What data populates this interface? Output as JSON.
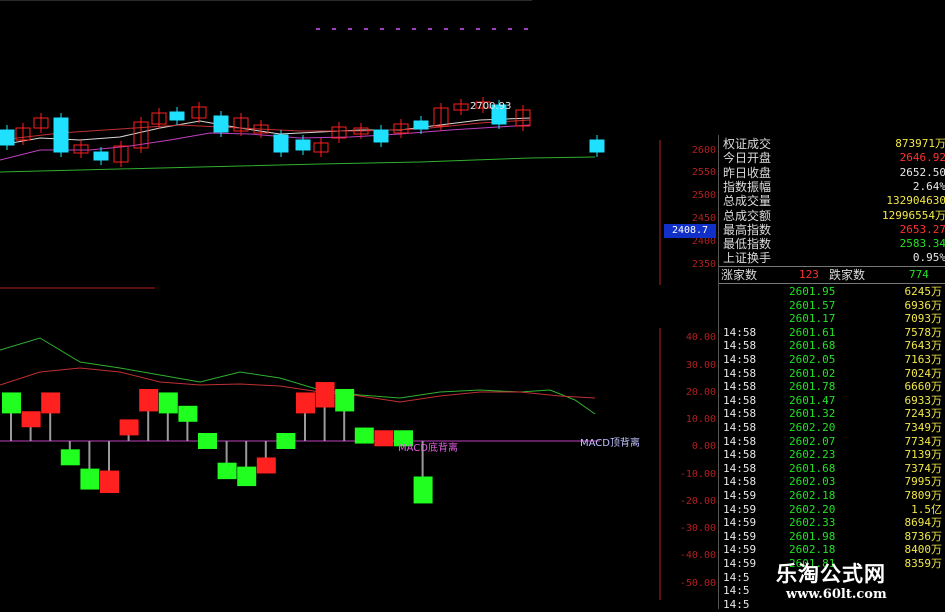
{
  "colors": {
    "up": "#ff2020",
    "down": "#20ff20",
    "axis": "#b02020",
    "ma_white": "#d8d8d8",
    "ma_purple": "#c040c0",
    "ma_green": "#30b030",
    "ma_red": "#c03030"
  },
  "price_chart": {
    "top_label": "2700.93",
    "axis_labels": [
      "2600",
      "2550",
      "2500",
      "2450",
      "2400",
      "2350"
    ],
    "current_price": "2408.7"
  },
  "quote_panel": {
    "rows": [
      {
        "label": "权证成交",
        "value": "873971万",
        "color": "#f2e84a"
      },
      {
        "label": "今日开盘",
        "value": "2646.92",
        "color": "#ff3030"
      },
      {
        "label": "昨日收盘",
        "value": "2652.50",
        "color": "#e8e8e8"
      },
      {
        "label": "指数振幅",
        "value": "2.64%",
        "color": "#e8e8e8"
      },
      {
        "label": "总成交量",
        "value": "132904630",
        "color": "#f2e84a"
      },
      {
        "label": "总成交额",
        "value": "12996554万",
        "color": "#f2e84a"
      },
      {
        "label": "最高指数",
        "value": "2653.27",
        "color": "#ff3030"
      },
      {
        "label": "最低指数",
        "value": "2583.34",
        "color": "#22e022"
      },
      {
        "label": "上证换手",
        "value": "0.95%",
        "color": "#e8e8e8"
      }
    ],
    "advance_label": "涨家数",
    "advance_value": "123",
    "decline_label": "跌家数",
    "decline_value": "774"
  },
  "ticks": [
    {
      "time": "",
      "price": "2601.95",
      "vol": "6245万"
    },
    {
      "time": "",
      "price": "2601.57",
      "vol": "6936万"
    },
    {
      "time": "",
      "price": "2601.17",
      "vol": "7093万"
    },
    {
      "time": "14:58",
      "price": "2601.61",
      "vol": "7578万"
    },
    {
      "time": "14:58",
      "price": "2601.68",
      "vol": "7643万"
    },
    {
      "time": "14:58",
      "price": "2602.05",
      "vol": "7163万"
    },
    {
      "time": "14:58",
      "price": "2601.02",
      "vol": "7024万"
    },
    {
      "time": "14:58",
      "price": "2601.78",
      "vol": "6660万"
    },
    {
      "time": "14:58",
      "price": "2601.47",
      "vol": "6933万"
    },
    {
      "time": "14:58",
      "price": "2601.32",
      "vol": "7243万"
    },
    {
      "time": "14:58",
      "price": "2602.20",
      "vol": "7349万"
    },
    {
      "time": "14:58",
      "price": "2602.07",
      "vol": "7734万"
    },
    {
      "time": "14:58",
      "price": "2602.23",
      "vol": "7139万"
    },
    {
      "time": "14:58",
      "price": "2601.68",
      "vol": "7374万"
    },
    {
      "time": "14:58",
      "price": "2602.03",
      "vol": "7995万"
    },
    {
      "time": "14:59",
      "price": "2602.18",
      "vol": "7809万"
    },
    {
      "time": "14:59",
      "price": "2602.20",
      "vol": "1.5亿"
    },
    {
      "time": "14:59",
      "price": "2602.33",
      "vol": "8694万"
    },
    {
      "time": "14:59",
      "price": "2601.98",
      "vol": "8736万"
    },
    {
      "time": "14:59",
      "price": "2602.18",
      "vol": "8400万"
    },
    {
      "time": "14:59",
      "price": "2601.81",
      "vol": "8359万"
    },
    {
      "time": "14:5",
      "price": "",
      "vol": ""
    },
    {
      "time": "14:5",
      "price": "",
      "vol": ""
    },
    {
      "time": "14:5",
      "price": "",
      "vol": ""
    }
  ],
  "indicator": {
    "axis_labels": [
      "40.00",
      "30.00",
      "20.00",
      "10.00",
      "0.00",
      "-10.00",
      "-20.00",
      "-30.00",
      "-40.00",
      "-50.00"
    ],
    "bars": [
      {
        "v": 14,
        "dir": "down"
      },
      {
        "v": 8,
        "dir": "up"
      },
      {
        "v": 14,
        "dir": "up"
      },
      {
        "v": -6,
        "dir": "down"
      },
      {
        "v": -14,
        "dir": "down"
      },
      {
        "v": -15,
        "dir": "up"
      },
      {
        "v": 5,
        "dir": "up"
      },
      {
        "v": 15,
        "dir": "up"
      },
      {
        "v": 14,
        "dir": "down"
      },
      {
        "v": 10,
        "dir": "down"
      },
      {
        "v": 0,
        "dir": "down"
      },
      {
        "v": -11,
        "dir": "down"
      },
      {
        "v": -13,
        "dir": "down"
      },
      {
        "v": -9,
        "dir": "up"
      },
      {
        "v": 0,
        "dir": "down"
      },
      {
        "v": 14,
        "dir": "up"
      },
      {
        "v": 17,
        "dir": "up"
      },
      {
        "v": 15,
        "dir": "down"
      },
      {
        "v": 2,
        "dir": "down"
      },
      {
        "v": 1,
        "dir": "up"
      },
      {
        "v": 1,
        "dir": "down"
      },
      {
        "v": -18,
        "dir": "down"
      }
    ],
    "annotation_left": "MACD底背离",
    "annotation_right": "MACD顶背离"
  },
  "watermark": {
    "name": "乐淘公式网",
    "url": "www.60lt.com"
  }
}
